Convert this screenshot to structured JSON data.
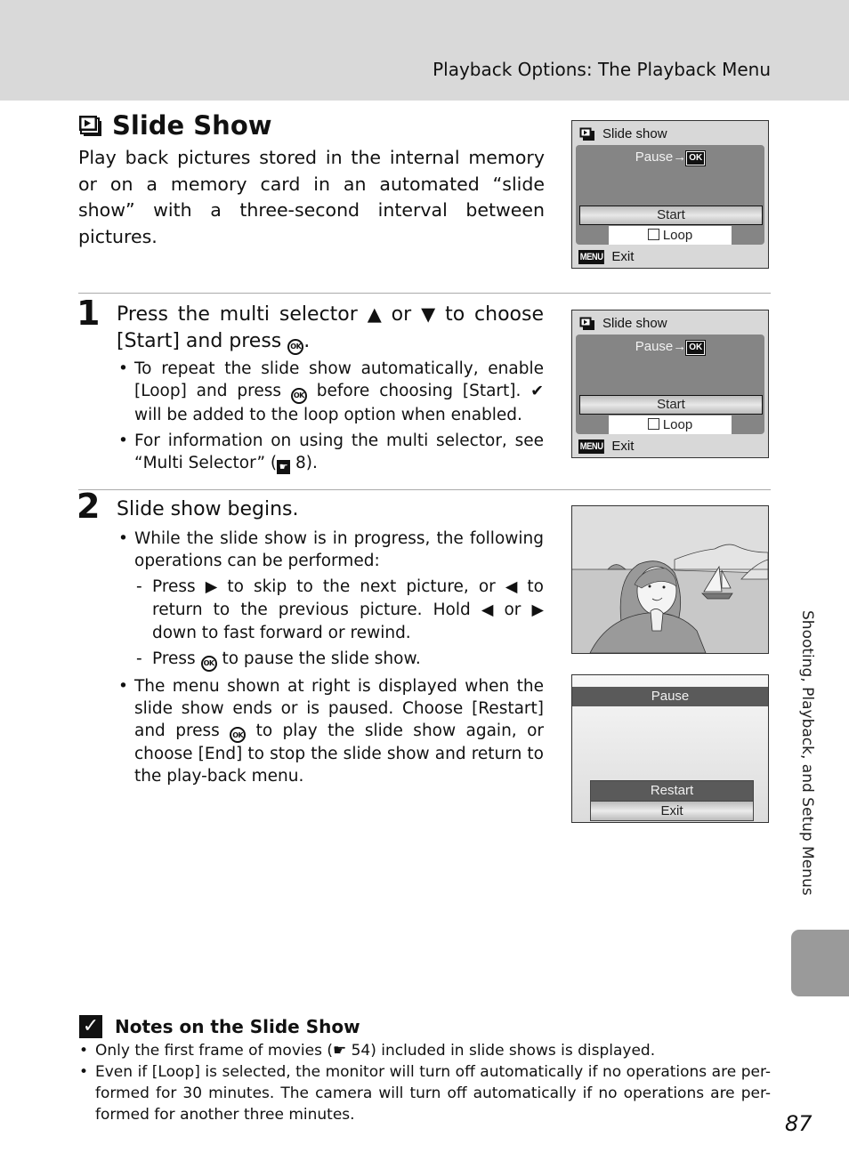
{
  "header": {
    "title": "Playback Options: The Playback Menu"
  },
  "section": {
    "icon": "slideshow-icon",
    "title": "Slide Show",
    "intro": "Play back pictures stored in the internal memory or on a memory card in an automated “slide show” with a three-second interval between pictures."
  },
  "steps": [
    {
      "number": "1",
      "heading_parts": [
        "Press the multi selector ",
        "▲",
        " or ",
        "▼",
        " to choose [Start] and press ",
        "OK",
        "."
      ],
      "bullets": [
        {
          "parts": [
            "To repeat the slide show automatically, enable [Loop] and press ",
            "OK",
            " before choosing [Start]. ",
            "✔",
            " will be added to the loop option when enabled."
          ]
        },
        {
          "parts": [
            "For information on using the multi selector, see “Multi Selector” (",
            "☛",
            " 8)."
          ]
        }
      ]
    },
    {
      "number": "2",
      "heading": "Slide show begins.",
      "bullets": [
        {
          "text": "While the slide show is in progress, the following operations can be performed:",
          "sub": [
            {
              "parts": [
                "Press ",
                "▶",
                "  to skip to the next picture, or ",
                "◀",
                " to return to the previous picture. Hold ",
                "◀",
                " or ",
                "▶",
                " down to fast forward or rewind."
              ]
            },
            {
              "parts": [
                "Press ",
                "OK",
                " to pause the slide show."
              ]
            }
          ]
        },
        {
          "parts": [
            "The menu shown at right is displayed when the slide show ends or is paused. Choose [Restart] and press ",
            "OK",
            " to play the slide show again, or choose [End] to stop the slide show and return to the play-back menu."
          ]
        }
      ]
    }
  ],
  "screens": {
    "slideshow_menu": {
      "title": "Slide show",
      "pause_label": "Pause→",
      "ok_label": "OK",
      "start_label": "Start",
      "loop_label": "Loop",
      "loop_checked": false,
      "menu_badge": "MENU",
      "exit_label": "Exit"
    },
    "pause_menu": {
      "title": "Pause",
      "options": [
        "Restart",
        "Exit"
      ],
      "selected": "Restart"
    },
    "photo": {
      "description": "Illustration of a smiling woman with hand under chin, sea with sailboat and hills in background"
    }
  },
  "side_tab": {
    "label": "Shooting, Playback, and Setup Menus"
  },
  "notes": {
    "title": "Notes on the Slide Show",
    "items": [
      "Only the first frame of movies (☛ 54) included in slide shows is displayed.",
      "Even if [Loop] is selected, the monitor will turn off automatically if no operations are per-formed for 30 minutes. The camera will turn off automatically if no operations are per-formed for another three minutes."
    ]
  },
  "page_number": "87"
}
